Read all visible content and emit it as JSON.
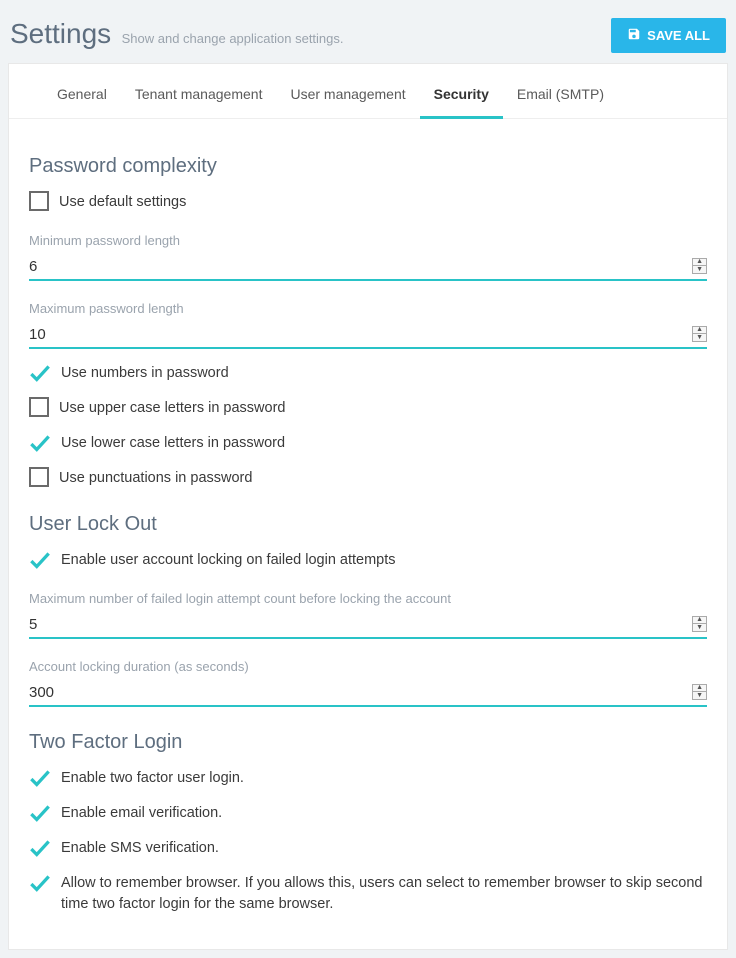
{
  "header": {
    "title": "Settings",
    "subtitle": "Show and change application settings.",
    "saveButton": "SAVE ALL"
  },
  "tabs": {
    "general": "General",
    "tenant": "Tenant management",
    "user": "User management",
    "security": "Security",
    "email": "Email (SMTP)"
  },
  "password": {
    "sectionTitle": "Password complexity",
    "useDefault": "Use default settings",
    "minLenLabel": "Minimum password length",
    "minLen": "6",
    "maxLenLabel": "Maximum password length",
    "maxLen": "10",
    "useNumbers": "Use numbers in password",
    "useUpper": "Use upper case letters in password",
    "useLower": "Use lower case letters in password",
    "usePunct": "Use punctuations in password"
  },
  "lockout": {
    "sectionTitle": "User Lock Out",
    "enable": "Enable user account locking on failed login attempts",
    "maxFailLabel": "Maximum number of failed login attempt count before locking the account",
    "maxFail": "5",
    "lockDurationLabel": "Account locking duration (as seconds)",
    "lockDuration": "300"
  },
  "twofactor": {
    "sectionTitle": "Two Factor Login",
    "enable": "Enable two factor user login.",
    "email": "Enable email verification.",
    "sms": "Enable SMS verification.",
    "remember": "Allow to remember browser. If you allows this, users can select to remember browser to skip second time two factor login for the same browser."
  }
}
